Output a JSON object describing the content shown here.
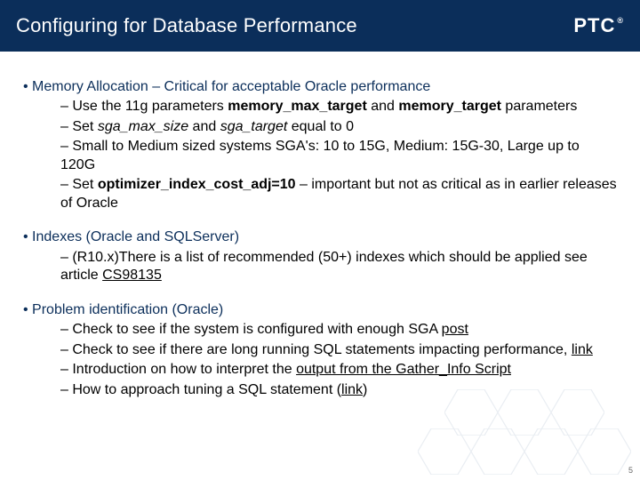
{
  "titlebar": {
    "title": "Configuring for Database Performance",
    "logo": "PTC",
    "reg": "®"
  },
  "sections": [
    {
      "hdr": "Memory Allocation – Critical for acceptable Oracle performance",
      "items": [
        {
          "pre": "Use the 11g parameters ",
          "b1": "memory_max_target",
          "mid": " and ",
          "b2": "memory_target",
          "post": " parameters"
        },
        {
          "pre": "Set ",
          "i1": "sga_max_size",
          "mid": " and ",
          "i2": "sga_target",
          "post": " equal to 0"
        },
        {
          "text": "Small to Medium sized systems SGA's: 10 to 15G, Medium: 15G-30, Large up to 120G"
        },
        {
          "pre": "Set ",
          "b1": "optimizer_index_cost_adj=10",
          "post": " – important but not as critical as in earlier releases of Oracle"
        }
      ]
    },
    {
      "hdr": "Indexes (Oracle and SQLServer)",
      "items": [
        {
          "pre": "(R10.x)There is a list of recommended (50+) indexes which should be applied see article ",
          "link": "CS98135"
        }
      ]
    },
    {
      "hdr": "Problem identification (Oracle)",
      "items": [
        {
          "pre": "Check to see if the system is configured with enough SGA ",
          "link": "post"
        },
        {
          "pre": "Check to see if there are long running SQL statements impacting performance, ",
          "link": "link"
        },
        {
          "pre": "Introduction on how to interpret the ",
          "ulink": "output from the Gather_Info Script"
        },
        {
          "pre": "How to approach tuning a SQL statement (",
          "link": "link",
          "post": ")"
        }
      ]
    }
  ],
  "page_number": "5"
}
